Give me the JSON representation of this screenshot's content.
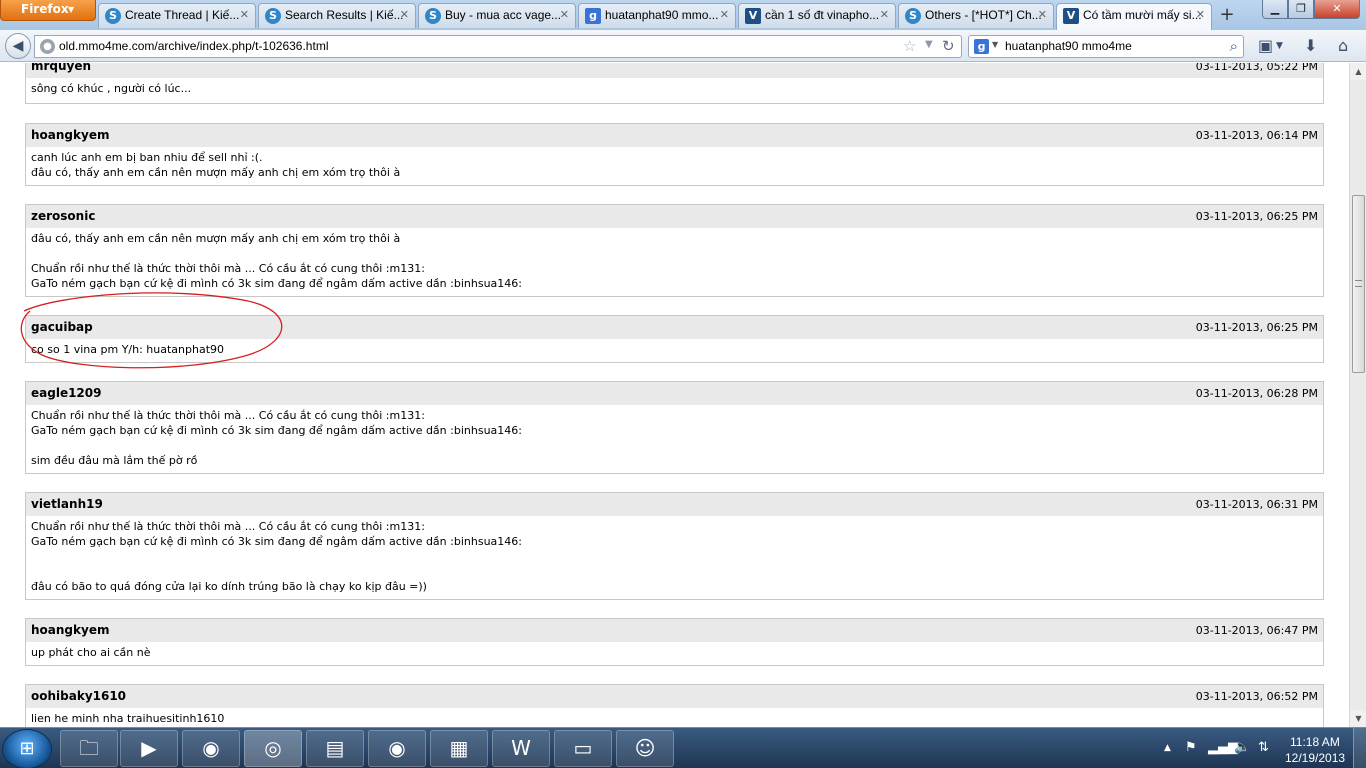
{
  "browser": {
    "menu_label": "Firefox",
    "tabs": [
      {
        "title": "Create Thread | Kiế...",
        "icon": "skype-icon"
      },
      {
        "title": "Search Results | Kiế...",
        "icon": "skype-icon"
      },
      {
        "title": "Buy - mua acc vage...",
        "icon": "skype-icon"
      },
      {
        "title": "huatanphat90 mmo...",
        "icon": "google-icon"
      },
      {
        "title": "cần 1 số đt vinapho...",
        "icon": "vbulletin-icon"
      },
      {
        "title": "Others - [*HOT*] Ch...",
        "icon": "skype-icon"
      },
      {
        "title": "Có tầm mười mấy si...",
        "icon": "vbulletin-icon"
      }
    ],
    "new_tab_label": "+",
    "url_host": "old.mmo4me.com",
    "url_path": "/archive/index.php/t-102636.html",
    "search_value": "huatanphat90 mmo4me"
  },
  "posts": [
    {
      "author": "mrquyen",
      "date": "03-11-2013, 05:22 PM",
      "lines": [
        "sông có khúc , người có lúc..."
      ]
    },
    {
      "author": "hoangkyem",
      "date": "03-11-2013, 06:14 PM",
      "lines": [
        "canh lúc anh em bị ban nhiu để sell nhỉ :(.",
        "đâu có, thấy anh em cần nên mượn mấy anh chị em xóm trọ thôi à"
      ]
    },
    {
      "author": "zerosonic",
      "date": "03-11-2013, 06:25 PM",
      "lines": [
        "đâu có, thấy anh em cần nên mượn mấy anh chị em xóm trọ thôi à",
        "",
        "Chuẩn rồi như thế là thức thời thôi mà ... Có cầu ắt có cung thôi :m131:",
        "GaTo ném gạch bạn cứ kệ đi mình có 3k sim đang để ngâm dấm active dần :binhsua146:"
      ]
    },
    {
      "author": "gacuibap",
      "date": "03-11-2013, 06:25 PM",
      "lines": [
        "co so 1 vina pm Y/h: huatanphat90"
      ]
    },
    {
      "author": "eagle1209",
      "date": "03-11-2013, 06:28 PM",
      "lines": [
        "Chuẩn rồi như thế là thức thời thôi mà ... Có cầu ắt có cung thôi :m131:",
        "GaTo ném gạch bạn cứ kệ đi mình có 3k sim đang để ngâm dấm active dần :binhsua146:",
        "",
        "sim đều đâu mà lắm thế pờ rồ"
      ]
    },
    {
      "author": "vietlanh19",
      "date": "03-11-2013, 06:31 PM",
      "lines": [
        "Chuẩn rồi như thế là thức thời thôi mà ... Có cầu ắt có cung thôi :m131:",
        "GaTo ném gạch bạn cứ kệ đi mình có 3k sim đang để ngâm dấm active dần :binhsua146:",
        "",
        "",
        "đâu có bão to quá đóng cửa lại ko dính trúng bão là chạy ko kịp đâu =))"
      ]
    },
    {
      "author": "hoangkyem",
      "date": "03-11-2013, 06:47 PM",
      "lines": [
        "up phát cho ai cần nè"
      ]
    },
    {
      "author": "oohibaky1610",
      "date": "03-11-2013, 06:52 PM",
      "lines": [
        "lien he minh nha traihuesitinh1610"
      ]
    }
  ],
  "annotation_color": "#d42020",
  "taskbar": {
    "apps": [
      "windows-explorer-icon",
      "media-player-icon",
      "chrome-icon",
      "firefox-icon",
      "sticky-notes-icon",
      "chrome-icon",
      "video-editor-icon",
      "word-icon",
      "remote-desktop-icon",
      "yahoo-messenger-icon"
    ],
    "time": "11:18 AM",
    "date": "12/19/2013"
  }
}
